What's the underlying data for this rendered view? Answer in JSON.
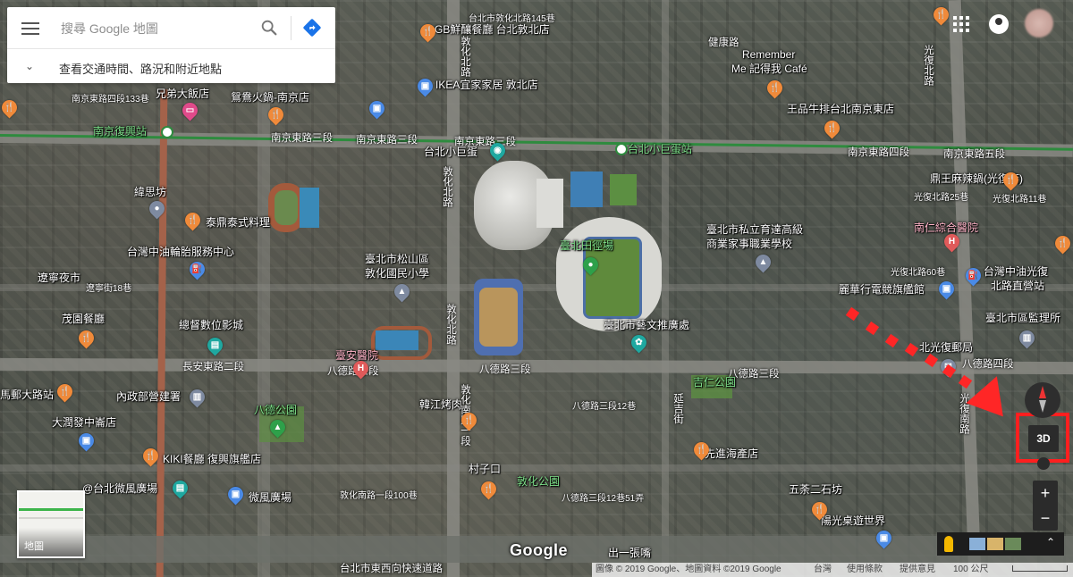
{
  "search": {
    "placeholder": "搜尋 Google 地圖",
    "sub_label": "查看交通時間、路況和附近地點"
  },
  "controls": {
    "three_d": "3D",
    "zoom_in": "+",
    "zoom_out": "−",
    "minimap_label": "地圖",
    "google_logo": "Google"
  },
  "footer": {
    "imagery": "圖像 © 2019 Google、地圖資料 ©2019 Google",
    "region": "台灣",
    "terms": "使用條款",
    "feedback": "提供意見",
    "scale": "100 公尺"
  },
  "places": [
    "台北市敦化北路145巷",
    "GB鮮釀餐廳 台北敦北店",
    "健康路",
    "Remember",
    "Me 記得我 Café",
    "IKEA宜家家居 敦北店",
    "南京東路四段133巷",
    "兄弟大飯店",
    "鴛鴦火鍋-南京店",
    "王品牛排台北南京東店",
    "南京復興站",
    "南京東路三段",
    "南京東路三段",
    "南京東路三段",
    "台北小巨蛋站",
    "台北小巨蛋",
    "南京東路四段",
    "南京東路五段",
    "鼎王麻辣鍋(光復店)",
    "光復北路25巷",
    "光復北路11巷",
    "緯思坊",
    "泰鼎泰式料理",
    "臺北市私立育達高級",
    "商業家事職業學校",
    "南仁綜合醫院",
    "臺北田徑場",
    "台灣中油輪胎服務中心",
    "臺北市松山區",
    "敦化國民小學",
    "光復北路60巷",
    "台灣中油光復",
    "北路直營站",
    "遼寧夜市",
    "遼寧街18巷",
    "麗華行電競旗艦館",
    "茂園餐廳",
    "總督數位影城",
    "臺北市藝文推廣處",
    "臺北市區監理所",
    "北光復郵局",
    "臺安醫院",
    "八德路三段",
    "八德路三段",
    "八德路三段",
    "八德路四段",
    "長安東路二段",
    "八德公園",
    "吉仁公園",
    "內政部營建署",
    "馬郵大路站",
    "大潤發中崙店",
    "韓江烤肉",
    "八德路三段12巷",
    "先進海產店",
    "KIKI餐廳 復興旗艦店",
    "@台北微風廣場",
    "微風廣場",
    "村子口",
    "敦化公園",
    "敦化南路一段100巷",
    "八德路三段12巷51弄",
    "五荼二石坊",
    "陽光桌遊世界",
    "出一張嘴",
    "台北市東西向快速道路"
  ],
  "roads_vertical": [
    "敦化北路",
    "敦化北路",
    "敦化南路一段",
    "光復北路",
    "光復南路",
    "敦化北路",
    "延吉街"
  ]
}
